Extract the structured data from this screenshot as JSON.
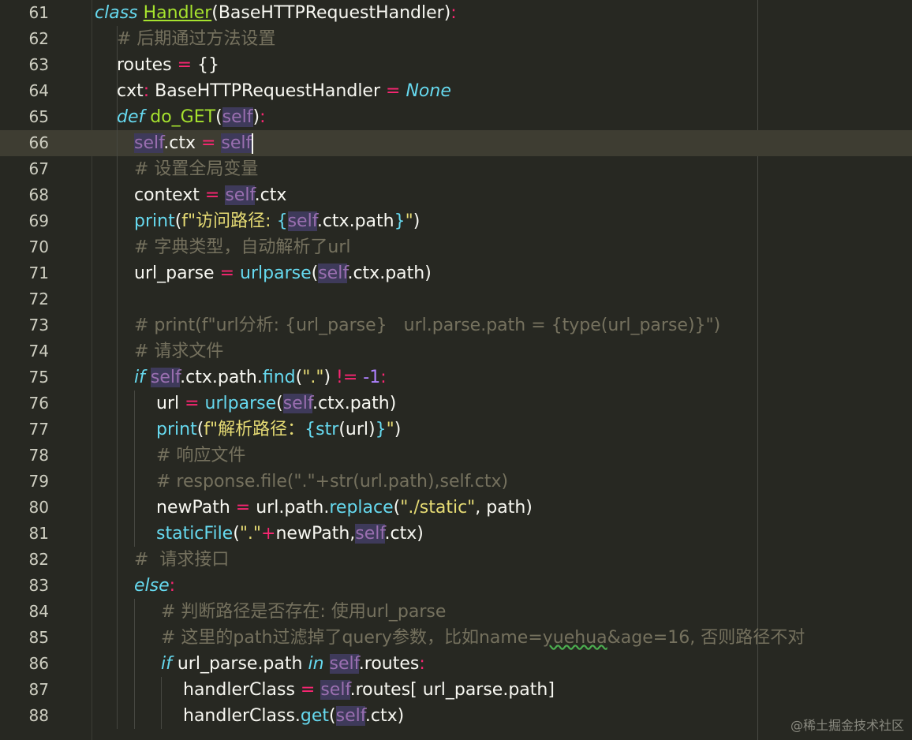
{
  "editor": {
    "lines": [
      {
        "n": "61",
        "t": [
          "class",
          " ",
          "Handler",
          "(BaseHTTPRequestHandler)",
          ":"
        ]
      },
      {
        "n": "62",
        "t": [
          "# 后期通过方法设置"
        ]
      },
      {
        "n": "63",
        "t": [
          "routes",
          " = ",
          "{}"
        ]
      },
      {
        "n": "64",
        "t": [
          "cxt",
          ": ",
          "BaseHTTPRequestHandler",
          " = ",
          "None"
        ]
      },
      {
        "n": "65",
        "t": [
          "def",
          " ",
          "do_GET",
          "(",
          "self",
          ")",
          ":"
        ]
      },
      {
        "n": "66",
        "t": [
          "self",
          ".ctx",
          " = ",
          "self"
        ]
      },
      {
        "n": "67",
        "t": [
          "# 设置全局变量"
        ]
      },
      {
        "n": "68",
        "t": [
          "context",
          " = ",
          "self",
          ".ctx"
        ]
      },
      {
        "n": "69",
        "t": [
          "print",
          "(",
          "f\"访问路径: ",
          "{",
          "self",
          ".ctx.path",
          "}",
          "\"",
          ")"
        ]
      },
      {
        "n": "70",
        "t": [
          "# 字典类型，自动解析了url"
        ]
      },
      {
        "n": "71",
        "t": [
          "url_parse",
          " = ",
          "urlparse",
          "(",
          "self",
          ".ctx.path)"
        ]
      },
      {
        "n": "72",
        "t": []
      },
      {
        "n": "73",
        "t": [
          "# print(f\"url分析: {url_parse}   url.parse.path = {type(url_parse)}\")"
        ]
      },
      {
        "n": "74",
        "t": [
          "# 请求文件"
        ]
      },
      {
        "n": "75",
        "t": [
          "if",
          " ",
          "self",
          ".ctx.path.",
          "find",
          "(",
          "\".\"",
          ") ",
          "!= ",
          "-1",
          ":"
        ]
      },
      {
        "n": "76",
        "t": [
          "url",
          " = ",
          "urlparse",
          "(",
          "self",
          ".ctx.path)"
        ]
      },
      {
        "n": "77",
        "t": [
          "print",
          "(",
          "f\"解析路径：",
          "{",
          "str",
          "(url)",
          "}",
          "\"",
          ")"
        ]
      },
      {
        "n": "78",
        "t": [
          "# 响应文件"
        ]
      },
      {
        "n": "79",
        "t": [
          "# response.file(\".\"+str(url.path),self.ctx)"
        ]
      },
      {
        "n": "80",
        "t": [
          "newPath",
          " = ",
          "url.path.",
          "replace",
          "(",
          "\"./static\"",
          ", path)"
        ]
      },
      {
        "n": "81",
        "t": [
          "staticFile",
          "(",
          "\".\"",
          "+",
          "newPath,",
          "self",
          ".ctx)"
        ]
      },
      {
        "n": "82",
        "t": [
          "#  请求接口"
        ]
      },
      {
        "n": "83",
        "t": [
          "else",
          ":"
        ]
      },
      {
        "n": "84",
        "t": [
          "# 判断路径是否存在: 使用url_parse"
        ]
      },
      {
        "n": "85",
        "t": [
          "# 这里的path过滤掉了query参数，比如name=",
          "yuehua",
          "&age=16, 否则路径不对"
        ]
      },
      {
        "n": "86",
        "t": [
          "if",
          " url_parse.path ",
          "in",
          " ",
          "self",
          ".routes",
          ":"
        ]
      },
      {
        "n": "87",
        "t": [
          "handlerClass",
          " = ",
          "self",
          ".routes[ url_parse.path]"
        ]
      },
      {
        "n": "88",
        "t": [
          "handlerClass.",
          "get",
          "(",
          "self",
          ".ctx)"
        ]
      }
    ]
  },
  "watermark": "@稀土掘金技术社区",
  "theme": {
    "background": "#272822",
    "active_line": "#3e3d32",
    "keyword": "#66d9ef",
    "function": "#a6e22e",
    "operator": "#f92672",
    "string": "#e6db74",
    "number": "#ae81ff",
    "comment": "#75715e",
    "self": "#9a6fb0"
  }
}
